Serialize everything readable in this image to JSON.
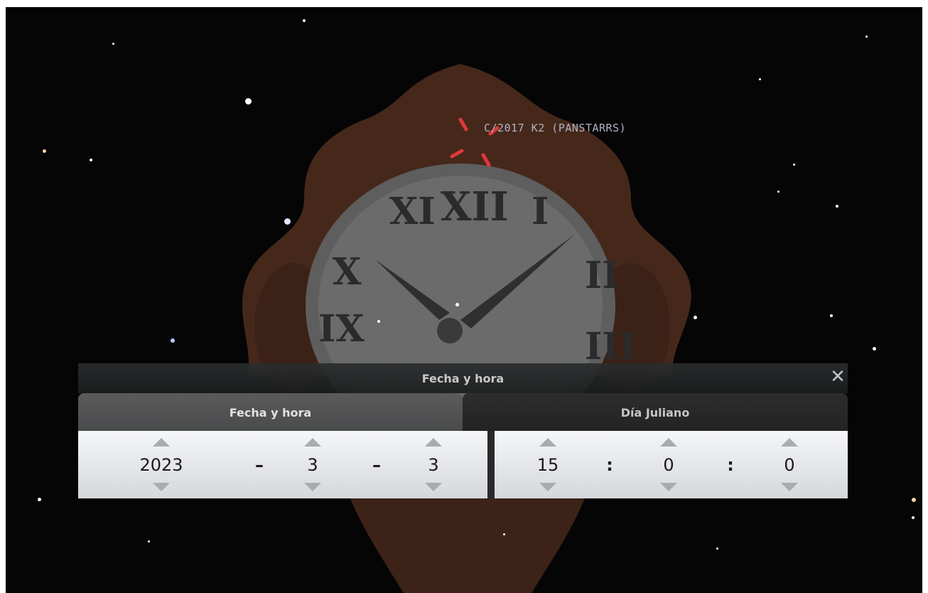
{
  "sky": {
    "object_label": "C/2017 K2 (PANSTARRS)"
  },
  "dialog": {
    "title": "Fecha y hora",
    "close_glyph": "✕",
    "tabs": [
      {
        "label": "Fecha y hora",
        "active": true
      },
      {
        "label": "Día Juliano",
        "active": false
      }
    ],
    "date": {
      "year": "2023",
      "month": "3",
      "day": "3",
      "separator": "–"
    },
    "time": {
      "hour": "15",
      "minute": "0",
      "second": "0",
      "separator": ":"
    }
  },
  "icons": {
    "close": "close-icon",
    "spin_up": "triangle-up-icon",
    "spin_down": "triangle-down-icon",
    "target_marker": "target-reticle-icon"
  },
  "colors": {
    "sky": "#050505",
    "marker": "#e0383c",
    "clock_frame": "#5a3222",
    "clock_face": "#6e6e6e",
    "dialog_bar": "#222425",
    "spin_panel": "#e6e7ea"
  }
}
